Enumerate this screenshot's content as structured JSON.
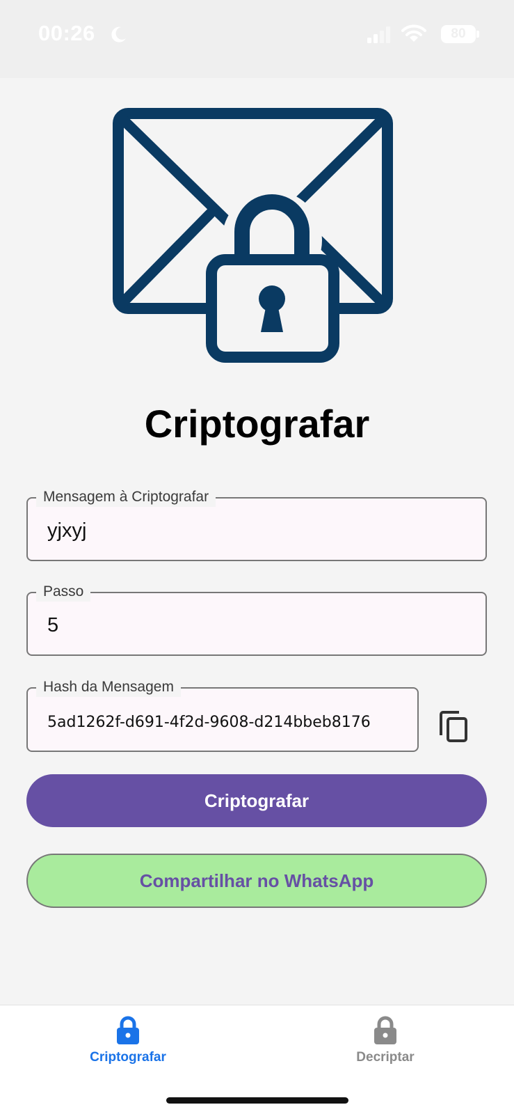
{
  "status_bar": {
    "time": "00:26",
    "battery": "80",
    "icons": [
      "moon-icon",
      "signal-icon",
      "wifi-icon",
      "battery-icon"
    ]
  },
  "hero": {
    "icon": "envelope-lock-icon",
    "color": "#0a3a62"
  },
  "page_title": "Criptografar",
  "form": {
    "message": {
      "label": "Mensagem à Criptografar",
      "value": "yjxyj"
    },
    "step": {
      "label": "Passo",
      "value": "5"
    },
    "hash": {
      "label": "Hash da Mensagem",
      "value": "5ad1262f-d691-4f2d-9608-d214bbeb8176",
      "copy_icon": "copy-icon"
    }
  },
  "buttons": {
    "encrypt_label": "Criptografar",
    "whatsapp_label": "Compartilhar no WhatsApp"
  },
  "tabs": [
    {
      "label": "Criptografar",
      "icon": "lock-icon",
      "active": true
    },
    {
      "label": "Decriptar",
      "icon": "lock-icon",
      "active": false
    }
  ],
  "colors": {
    "primary": "#6650a4",
    "whatsapp": "#a9eb9d",
    "tab_active": "#1a73e8",
    "tab_inactive": "#8a8a8a"
  }
}
